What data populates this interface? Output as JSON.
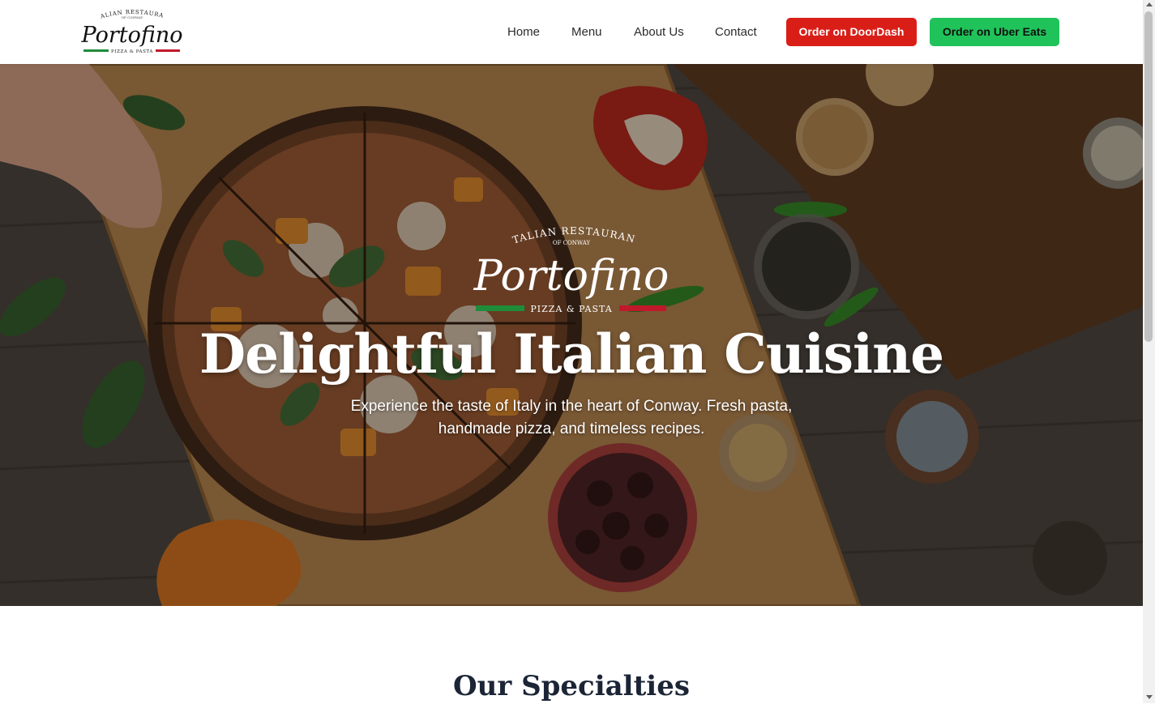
{
  "brand": {
    "arc_text": "ITALIAN RESTAURANT",
    "sub_arc_text": "OF CONWAY",
    "name": "Portofino",
    "tagline": "PIZZA & PASTA",
    "flag_green": "#1f8c3a",
    "flag_red": "#c0192b"
  },
  "nav": {
    "items": [
      {
        "label": "Home"
      },
      {
        "label": "Menu"
      },
      {
        "label": "About Us"
      },
      {
        "label": "Contact"
      }
    ],
    "doordash_label": "Order on DoorDash",
    "ubereats_label": "Order on Uber Eats",
    "doordash_color": "#d91e18",
    "ubereats_color": "#1fc35a"
  },
  "hero": {
    "title": "Delightful Italian Cuisine",
    "subtitle": "Experience the taste of Italy in the heart of Conway. Fresh pasta, handmade pizza, and timeless recipes."
  },
  "specialties": {
    "title": "Our Specialties"
  }
}
